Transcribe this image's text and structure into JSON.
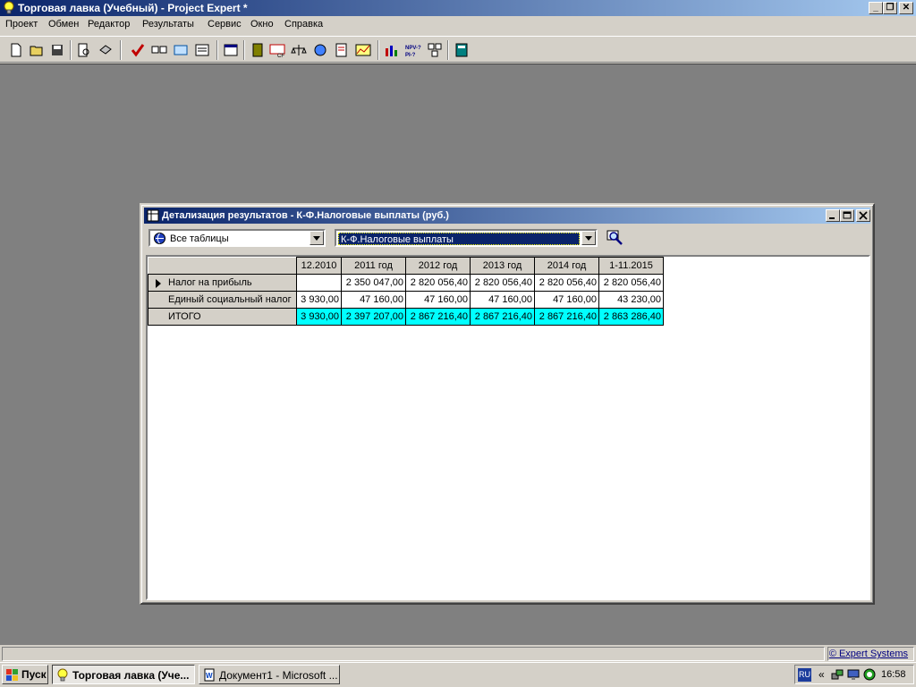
{
  "app": {
    "title": "Торговая лавка (Учебный) - Project Expert *"
  },
  "menu": [
    "Проект",
    "Обмен",
    "Редактор",
    "Результаты",
    "Сервис",
    "Окно",
    "Справка"
  ],
  "child_window": {
    "title": "Детализация результатов - К-Ф.Налоговые выплаты (руб.)",
    "table_selector_value": "Все таблицы",
    "row_selector_value": "К-Ф.Налоговые выплаты"
  },
  "grid": {
    "columns": [
      "12.2010",
      "2011 год",
      "2012 год",
      "2013 год",
      "2014 год",
      "1-11.2015"
    ],
    "rows": [
      {
        "label": "Налог на прибыль",
        "values": [
          "",
          "2 350 047,00",
          "2 820 056,40",
          "2 820 056,40",
          "2 820 056,40",
          "2 820 056,40"
        ]
      },
      {
        "label": "Единый социальный налог",
        "values": [
          "3 930,00",
          "47 160,00",
          "47 160,00",
          "47 160,00",
          "47 160,00",
          "43 230,00"
        ]
      },
      {
        "label": "ИТОГО",
        "values": [
          "3 930,00",
          "2 397 207,00",
          "2 867 216,40",
          "2 867 216,40",
          "2 867 216,40",
          "2 863 286,40"
        ]
      }
    ]
  },
  "status": {
    "link": "© Expert Systems"
  },
  "taskbar": {
    "start_label": "Пуск",
    "tasks": [
      "Торговая лавка (Уче...",
      "Документ1 - Microsoft ..."
    ],
    "lang": "RU",
    "clock": "16:58"
  },
  "colors": {
    "title_gradient_start": "#0a246a",
    "title_gradient_end": "#a6caf0",
    "total_row_bg": "#00ffff",
    "mdi_bg": "#808080"
  }
}
